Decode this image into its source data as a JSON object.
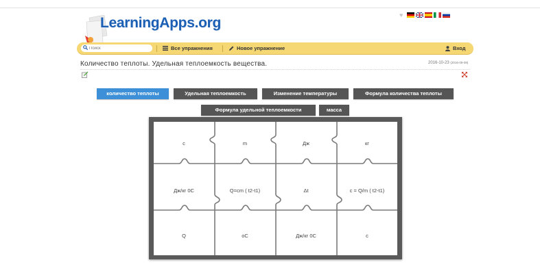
{
  "header": {
    "logo_text": "LearningApps.org",
    "language_heart": "♥",
    "flags": [
      {
        "name": "flag-germany",
        "colors": [
          "#000000",
          "#dd0000",
          "#ffce00"
        ]
      },
      {
        "name": "flag-uk",
        "colors": [
          "#012169",
          "#ffffff",
          "#c8102e"
        ]
      },
      {
        "name": "flag-spain",
        "colors": [
          "#c60b1e",
          "#ffc400",
          "#c60b1e"
        ]
      },
      {
        "name": "flag-italy",
        "colors": [
          "#009246",
          "#ffffff",
          "#ce2b37"
        ]
      },
      {
        "name": "flag-russia",
        "colors": [
          "#ffffff",
          "#0039a6",
          "#d52b1e"
        ]
      }
    ]
  },
  "navbar": {
    "search_placeholder": "Поиск",
    "all_exercises": "Все упражнения",
    "new_exercise": "Новое упражнение",
    "login": "Вход"
  },
  "page": {
    "title": "Количество теплоты. Удельная теплоемкость вещества.",
    "date": "2016-10-23",
    "date_small": "(2016-09-08)"
  },
  "tabs": [
    {
      "label": "количество теплоты",
      "active": true
    },
    {
      "label": "Удельная теплоемкость",
      "active": false
    },
    {
      "label": "Изменение температуры",
      "active": false
    },
    {
      "label": "Формула количества теплоты",
      "active": false
    },
    {
      "label": "Формула удельной теплоемкости",
      "active": false
    },
    {
      "label": "масса",
      "active": false
    }
  ],
  "puzzle": {
    "rows": [
      [
        "c",
        "m",
        "Дж",
        "кг"
      ],
      [
        "Дж/кг 0С",
        "Q=cm ( t2-t1)",
        "Δt",
        "c = Q/m ( t2-t1)"
      ],
      [
        "Q",
        "oC",
        "Дж/кг 0С",
        "c"
      ]
    ]
  },
  "colors": {
    "navbar": "#f5d773",
    "tab_active": "#3d90d8",
    "tab_inactive": "#555555",
    "board": "#5a5a5a",
    "logo_blue": "#1b5fb5"
  }
}
